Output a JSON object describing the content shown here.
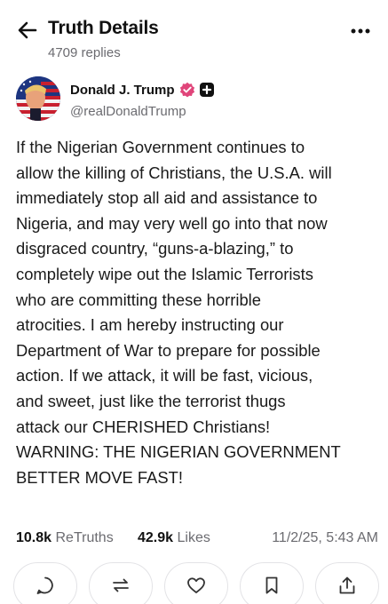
{
  "header": {
    "title": "Truth Details",
    "replies": "4709 replies",
    "back_icon": "arrow-left-icon",
    "more_icon": "more-dots-icon"
  },
  "author": {
    "display_name": "Donald J. Trump",
    "handle": "@realDonaldTrump",
    "verified_color": "#e0457a",
    "badge": "plus-badge-icon"
  },
  "post": {
    "text": "If the Nigerian Government continues to\nallow the killing of Christians, the U.S.A. will\nimmediately stop all aid and assistance to\nNigeria, and may very well go into that now\ndisgraced country, “guns-a-blazing,” to\ncompletely wipe out the Islamic Terrorists\nwho are committing these horrible\natrocities. I am hereby instructing our\nDepartment of War to prepare for possible\naction. If we attack, it will be fast, vicious,\nand sweet, just like the terrorist thugs\nattack our CHERISHED Christians!\nWARNING: THE NIGERIAN GOVERNMENT\nBETTER MOVE FAST!"
  },
  "stats": {
    "retruths_count": "10.8k",
    "retruths_label": "ReTruths",
    "likes_count": "42.9k",
    "likes_label": "Likes",
    "timestamp": "11/2/25, 5:43 AM"
  },
  "actions": [
    "reply-icon",
    "retruth-icon",
    "heart-icon",
    "bookmark-icon",
    "share-icon"
  ],
  "colors": {
    "text": "#111111",
    "muted": "#6b6b70",
    "border": "#e3e3e6"
  }
}
